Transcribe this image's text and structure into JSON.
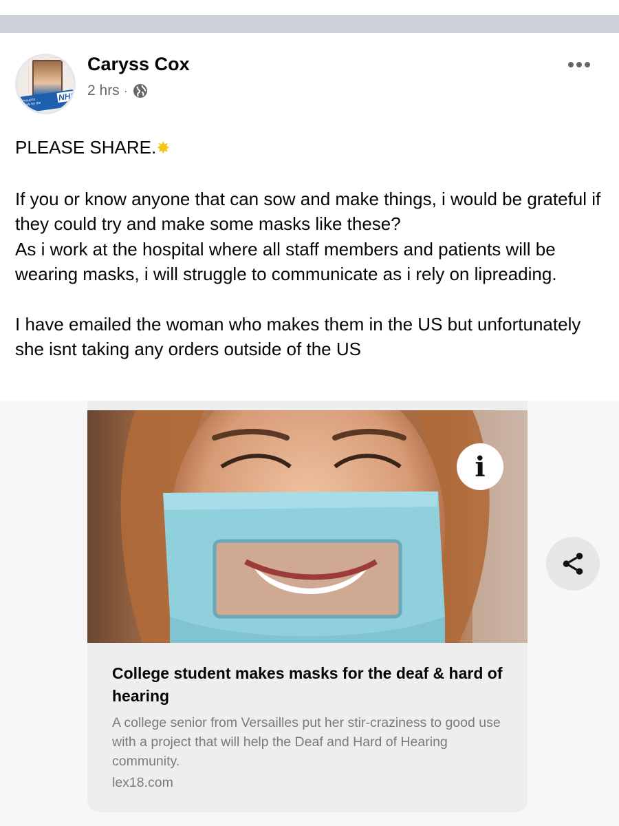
{
  "post": {
    "author": "Caryss Cox",
    "time": "2 hrs",
    "separator": "·",
    "avatar_badge": "NHS",
    "avatar_tagline": "Proud to work for the",
    "text": {
      "line1": "PLEASE SHARE.",
      "para2": "If you or know anyone that can sow and make things, i would be grateful if they could try and make some masks like these?\nAs i work at the hospital where all staff members and patients will be wearing masks, i will struggle to communicate as i rely on lipreading.",
      "para3": "I have emailed the woman who makes them in the US but unfortunately she isnt taking any orders outside of the US"
    }
  },
  "link_card": {
    "title": "College student makes masks for the deaf & hard of hearing",
    "description": "A college senior from Versailles put her stir-craziness to good use with a project that will help the Deaf and Hard of Hearing community.",
    "domain": "lex18.com",
    "info_label": "i"
  },
  "icons": {
    "globe": "globe-icon",
    "more": "more-options-icon",
    "share": "share-icon",
    "sparkle": "sparkle-icon"
  },
  "colors": {
    "top_bar": "#cdd0d6",
    "secondary_text": "#65676b",
    "card_background": "#eeeeee"
  }
}
